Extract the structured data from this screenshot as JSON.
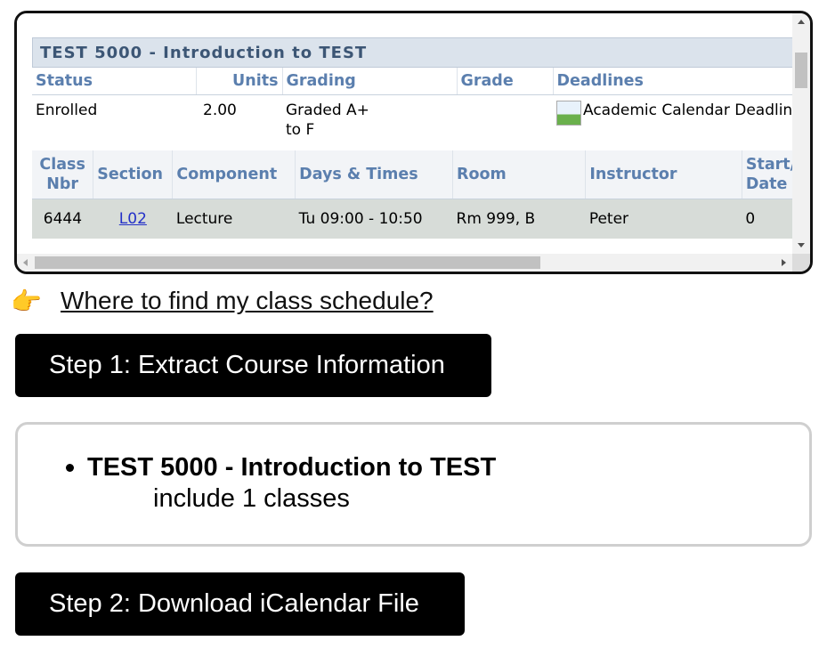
{
  "course": {
    "title": "TEST 5000 - Introduction to TEST",
    "status_table": {
      "headers": [
        "Status",
        "Units",
        "Grading",
        "Grade",
        "Deadlines"
      ],
      "row": {
        "status": "Enrolled",
        "units": "2.00",
        "grading": "Graded A+ to F",
        "grade": "",
        "deadlines": "Academic Calendar Deadlines"
      }
    },
    "class_table": {
      "headers": [
        "Class Nbr",
        "Section",
        "Component",
        "Days & Times",
        "Room",
        "Instructor",
        "Start/End Date"
      ],
      "rows": [
        {
          "class_nbr": "6444",
          "section": "L02",
          "component": "Lecture",
          "days_times": "Tu 09:00 - 10:50",
          "room": "Rm 999, B",
          "instructor": "Peter",
          "start_end": "0"
        }
      ]
    }
  },
  "help": {
    "icon": "pointing-hand-icon",
    "link_text": "Where to find my class schedule?"
  },
  "steps": {
    "step1_label": "Step 1: Extract Course Information",
    "step2_label": "Step 2: Download iCalendar File"
  },
  "results": {
    "items": [
      {
        "name": "TEST 5000 - Introduction to TEST",
        "detail": "include 1 classes"
      }
    ]
  },
  "colors": {
    "header_text": "#5b7fae",
    "title_bg": "#dbe3ec",
    "row_bg": "#d7dcd8",
    "button_bg": "#000000",
    "link": "#2330c8"
  }
}
